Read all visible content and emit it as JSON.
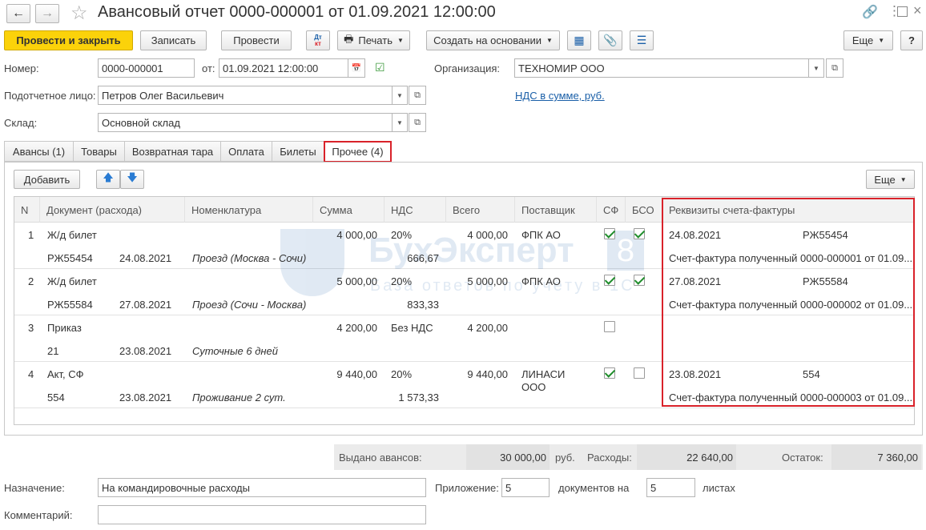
{
  "window": {
    "title": "Авансовый отчет 0000-000001 от 01.09.2021 12:00:00"
  },
  "toolbar": {
    "post_close": "Провести и закрыть",
    "save": "Записать",
    "post": "Провести",
    "dtkt_top": "Дт",
    "dtkt_bottom": "кт",
    "print": "Печать",
    "create_based": "Создать на основании",
    "more": "Еще",
    "help": "?"
  },
  "form": {
    "number_label": "Номер:",
    "number_value": "0000-000001",
    "from_label": "от:",
    "date_value": "01.09.2021 12:00:00",
    "org_label": "Организация:",
    "org_value": "ТЕХНОМИР ООО",
    "person_label": "Подотчетное лицо:",
    "person_value": "Петров Олег Васильевич",
    "vat_link": "НДС в сумме, руб.",
    "warehouse_label": "Склад:",
    "warehouse_value": "Основной склад"
  },
  "tabs": [
    {
      "label": "Авансы (1)"
    },
    {
      "label": "Товары"
    },
    {
      "label": "Возвратная тара"
    },
    {
      "label": "Оплата"
    },
    {
      "label": "Билеты"
    },
    {
      "label": "Прочее (4)"
    }
  ],
  "table_toolbar": {
    "add": "Добавить",
    "more": "Еще"
  },
  "table": {
    "headers": [
      "N",
      "Документ (расхода)",
      "Номенклатура",
      "Сумма",
      "НДС",
      "Всего",
      "Поставщик",
      "СФ",
      "БСО",
      "Реквизиты счета-фактуры"
    ],
    "rows": [
      {
        "n": "1",
        "doc": "Ж/д билет",
        "doc_num": "РЖ55454",
        "doc_date": "24.08.2021",
        "item": "Проезд (Москва - Сочи)",
        "sum": "4 000,00",
        "vat_rate": "20%",
        "vat_sum": "666,67",
        "total": "4 000,00",
        "supplier": "ФПК АО",
        "supplier2": "",
        "sf": true,
        "bso": true,
        "inv_date": "24.08.2021",
        "inv_num": "РЖ55454",
        "inv_text": "Счет-фактура полученный 0000-000001 от 01.09...."
      },
      {
        "n": "2",
        "doc": "Ж/д билет",
        "doc_num": "РЖ55584",
        "doc_date": "27.08.2021",
        "item": "Проезд (Сочи - Москва)",
        "sum": "5 000,00",
        "vat_rate": "20%",
        "vat_sum": "833,33",
        "total": "5 000,00",
        "supplier": "ФПК АО",
        "supplier2": "",
        "sf": true,
        "bso": true,
        "inv_date": "27.08.2021",
        "inv_num": "РЖ55584",
        "inv_text": "Счет-фактура полученный 0000-000002 от 01.09...."
      },
      {
        "n": "3",
        "doc": "Приказ",
        "doc_num": "21",
        "doc_date": "23.08.2021",
        "item": "Суточные 6 дней",
        "sum": "4 200,00",
        "vat_rate": "Без НДС",
        "vat_sum": "",
        "total": "4 200,00",
        "supplier": "",
        "supplier2": "",
        "sf": false,
        "bso": null,
        "inv_date": "",
        "inv_num": "",
        "inv_text": ""
      },
      {
        "n": "4",
        "doc": "Акт, СФ",
        "doc_num": "554",
        "doc_date": "23.08.2021",
        "item": "Проживание 2 сут.",
        "sum": "9 440,00",
        "vat_rate": "20%",
        "vat_sum": "1 573,33",
        "total": "9 440,00",
        "supplier": "ЛИНАСИ",
        "supplier2": "ООО",
        "sf": true,
        "bso": false,
        "inv_date": "23.08.2021",
        "inv_num": "554",
        "inv_text": "Счет-фактура полученный 0000-000003 от 01.09...."
      }
    ]
  },
  "watermark": {
    "brand": "БухЭксперт",
    "digit": "8",
    "tagline": "База ответов по учёту в 1С"
  },
  "totals": {
    "advances_label": "Выдано авансов:",
    "advances_value": "30 000,00",
    "currency": "руб.",
    "expenses_label": "Расходы:",
    "expenses_value": "22 640,00",
    "balance_label": "Остаток:",
    "balance_value": "7 360,00"
  },
  "footer": {
    "purpose_label": "Назначение:",
    "purpose_value": "На командировочные расходы",
    "attachment_label": "Приложение:",
    "attachment_value": "5",
    "docs_on_label": "документов на",
    "sheets_value": "5",
    "sheets_label": "листах",
    "comment_label": "Комментарий:",
    "comment_value": ""
  },
  "colors": {
    "accent": "#fbd20a",
    "highlight": "#d9222a",
    "link": "#1a5fa8",
    "check": "#1f8d2b"
  }
}
